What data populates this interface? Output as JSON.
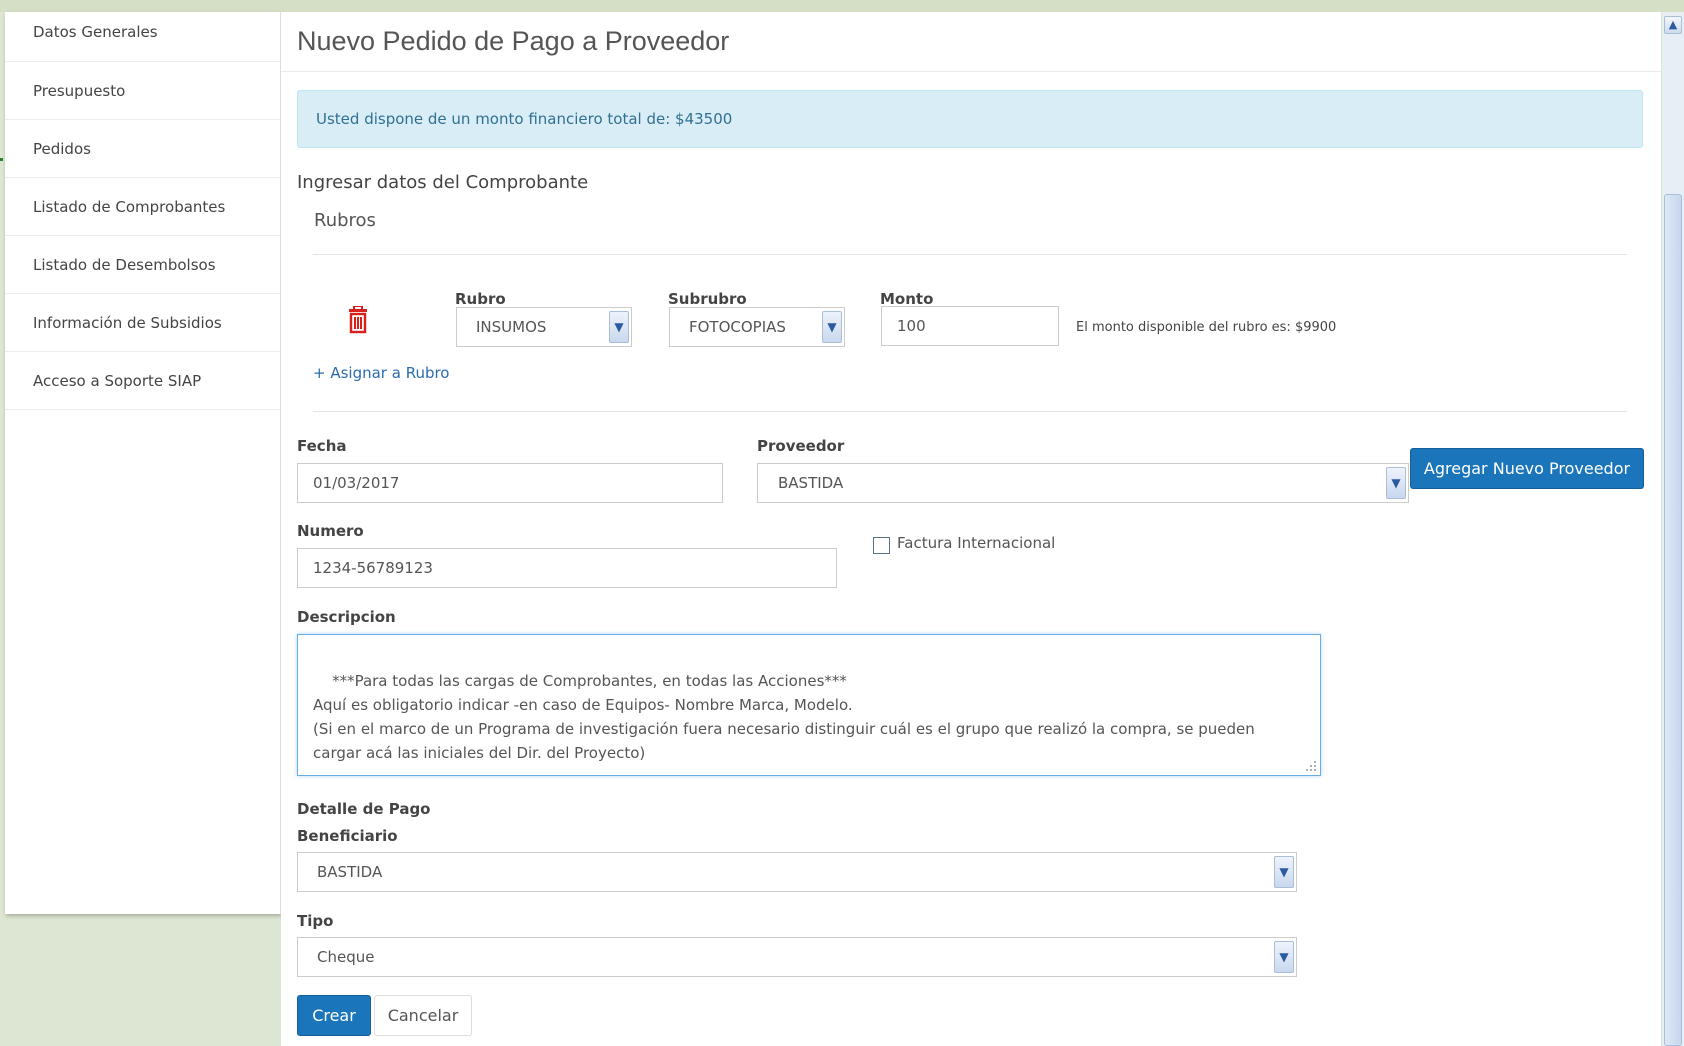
{
  "sidebar": {
    "items": [
      {
        "label": "Datos Generales"
      },
      {
        "label": "Presupuesto"
      },
      {
        "label": "Pedidos"
      },
      {
        "label": "Listado de Comprobantes"
      },
      {
        "label": "Listado de Desembolsos"
      },
      {
        "label": "Información de Subsidios"
      },
      {
        "label": "Acceso a Soporte SIAP"
      }
    ]
  },
  "page": {
    "title": "Nuevo Pedido de Pago a Proveedor",
    "alert": "Usted dispone de un monto financiero total de: $43500"
  },
  "comprobante": {
    "section_title": "Ingresar datos del Comprobante",
    "rubros_title": "Rubros",
    "rubro_label": "Rubro",
    "rubro_value": "INSUMOS",
    "subrubro_label": "Subrubro",
    "subrubro_value": "FOTOCOPIAS",
    "monto_label": "Monto",
    "monto_value": "100",
    "monto_note": "El monto disponible del rubro es: $9900",
    "asignar_link": "+ Asignar a Rubro",
    "fecha_label": "Fecha",
    "fecha_value": "01/03/2017",
    "proveedor_label": "Proveedor",
    "proveedor_value": "BASTIDA",
    "agregar_proveedor_button": "Agregar Nuevo Proveedor",
    "numero_label": "Numero",
    "numero_value": "1234-56789123",
    "factura_internacional_label": "Factura Internacional",
    "descripcion_label": "Descripcion",
    "descripcion_value": "***Para todas las cargas de Comprobantes, en todas las Acciones***\nAquí es obligatorio indicar -en caso de Equipos- Nombre Marca, Modelo.\n(Si en el marco de un Programa de investigación fuera necesario distinguir cuál es el grupo que realizó la compra, se pueden cargar acá las iniciales del Dir. del Proyecto)"
  },
  "pago": {
    "detalle_title": "Detalle de Pago",
    "beneficiario_label": "Beneficiario",
    "beneficiario_value": "BASTIDA",
    "tipo_label": "Tipo",
    "tipo_value": "Cheque"
  },
  "actions": {
    "crear": "Crear",
    "cancelar": "Cancelar"
  },
  "icons": {
    "delete": "trash-icon",
    "dropdown": "chevron-down-icon"
  },
  "colors": {
    "primary": "#1b75bb",
    "danger": "#d9201c",
    "alert_bg": "#d9edf7",
    "alert_text": "#31708f"
  }
}
